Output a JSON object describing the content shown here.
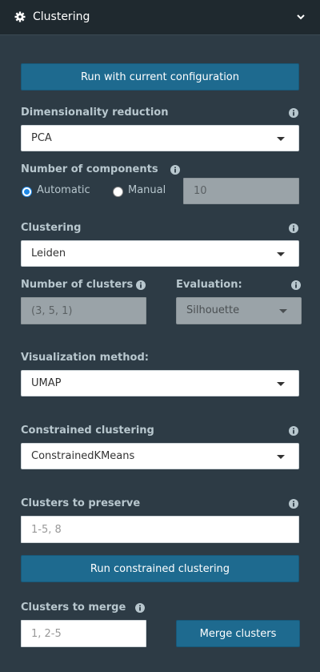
{
  "header": {
    "title": "Clustering",
    "icon": "gear-icon",
    "toggle_icon": "chevron-down-icon"
  },
  "run_button": "Run with current configuration",
  "dim_reduction": {
    "label": "Dimensionality reduction",
    "value": "PCA"
  },
  "components": {
    "label": "Number of components",
    "automatic_label": "Automatic",
    "manual_label": "Manual",
    "selected": "Automatic",
    "value_placeholder": "10"
  },
  "clustering": {
    "label": "Clustering",
    "value": "Leiden"
  },
  "num_clusters": {
    "label": "Number of clusters",
    "placeholder": "(3, 5, 1)"
  },
  "evaluation": {
    "label": "Evaluation:",
    "value": "Silhouette"
  },
  "visualization": {
    "label": "Visualization method:",
    "value": "UMAP"
  },
  "constrained": {
    "label": "Constrained clustering",
    "value": "ConstrainedKMeans"
  },
  "preserve": {
    "label": "Clusters to preserve",
    "placeholder": "1-5, 8"
  },
  "run_constrained_button": "Run constrained clustering",
  "merge": {
    "label": "Clusters to merge",
    "placeholder": "1, 2-5",
    "button": "Merge clusters"
  },
  "colors": {
    "background": "#2d3b45",
    "accent": "#1e6a8f",
    "header": "#1f292f"
  }
}
